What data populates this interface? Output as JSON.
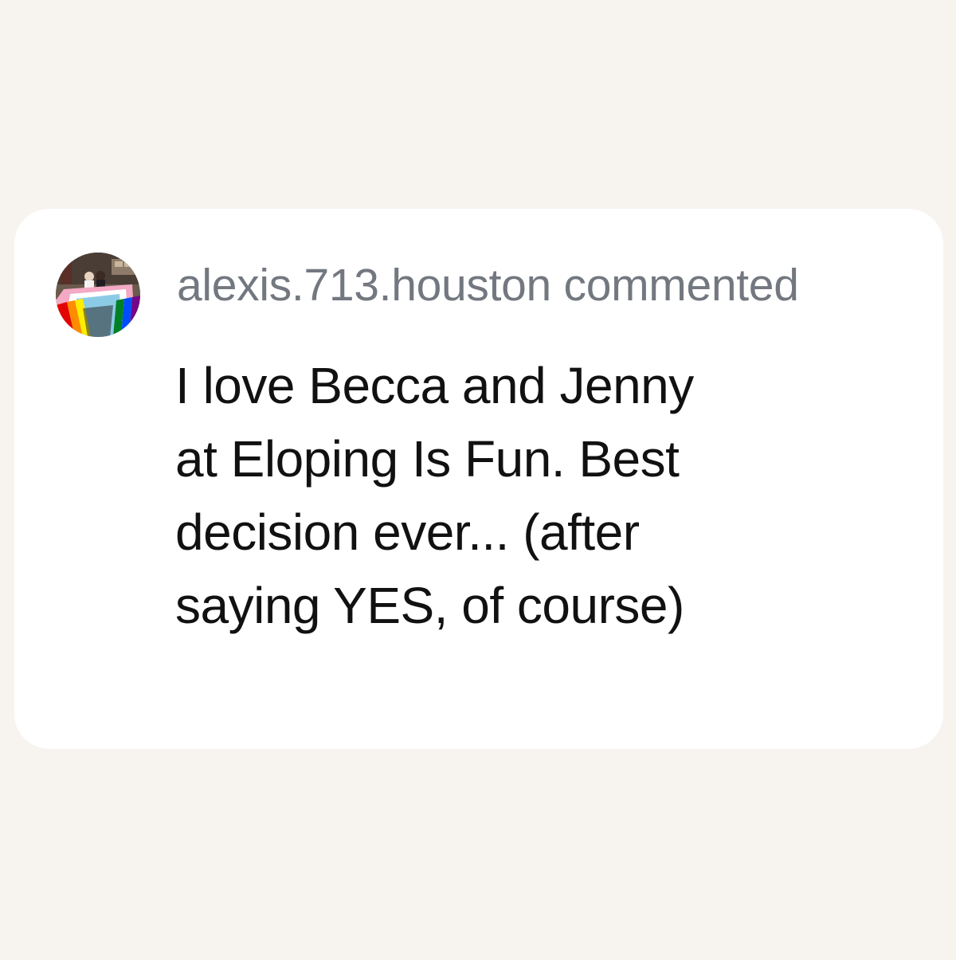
{
  "comment": {
    "username": "alexis.713.houston",
    "action": "commented",
    "text": "I love Becca and Jenny at Eloping Is Fun. Best decision ever... (after saying YES, of course)",
    "avatar": "user-avatar-photo"
  },
  "colors": {
    "page_background": "#f7f4ef",
    "card_background": "#ffffff",
    "header_text": "#737880",
    "body_text": "#111111"
  }
}
